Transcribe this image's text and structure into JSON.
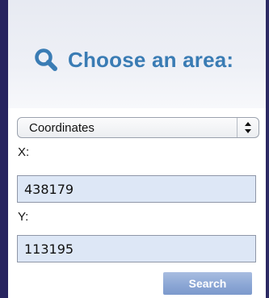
{
  "header": {
    "title": "Choose an area:",
    "icon": "search-icon"
  },
  "area_select": {
    "selected": "Coordinates",
    "options": [
      "Coordinates"
    ]
  },
  "x_field": {
    "label": "X:",
    "value": "438179"
  },
  "y_field": {
    "label": "Y:",
    "value": "113195"
  },
  "search_button": {
    "label": "Search"
  },
  "colors": {
    "frame": "#27245f",
    "title": "#3a7cb4",
    "input_bg": "#dde7f6",
    "button": "#8ca7d5"
  }
}
